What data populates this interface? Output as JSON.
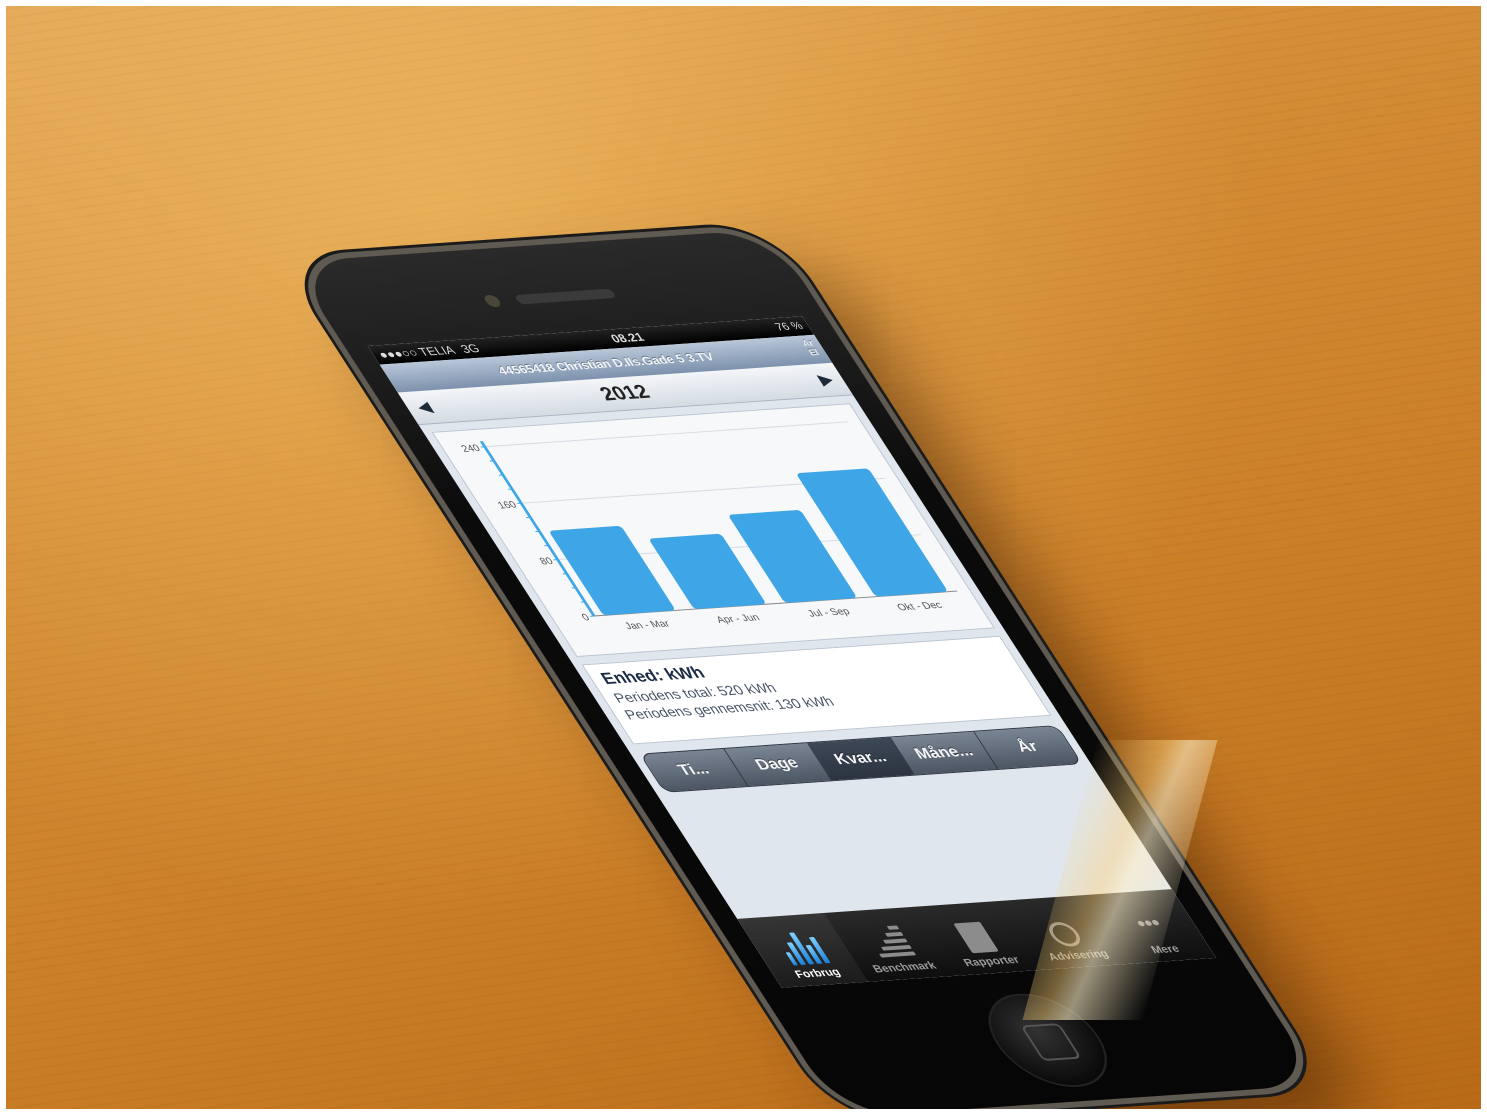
{
  "status": {
    "carrier": "●●●○○ TELIA",
    "network": "3G",
    "time": "08.21",
    "battery": "76 %"
  },
  "header": {
    "title": "44565418 Christian D.Ils.Gade 5 3.TV",
    "corner_top": "Ar",
    "corner_bottom": "El"
  },
  "period": {
    "year": "2012",
    "prev_arrow": "◀",
    "next_arrow": "▶"
  },
  "chart_data": {
    "type": "bar",
    "categories": [
      "Jan - Mar",
      "Apr - Jun",
      "Jul - Sep",
      "Okt - Dec"
    ],
    "values": [
      120,
      100,
      125,
      175
    ],
    "ylim": [
      0,
      240
    ],
    "yticks": [
      "0",
      "80",
      "160",
      "240"
    ],
    "bar_color": "#3ea6e6",
    "grid": true
  },
  "summary": {
    "unit": "Enhed: kWh",
    "total": "Periodens total: 520 kWh",
    "average": "Periodens gennemsnit: 130 kWh"
  },
  "segments": [
    "Ti...",
    "Dage",
    "Kvar...",
    "Måne...",
    "År"
  ],
  "segment_active": 2,
  "tabs": [
    {
      "label": "Forbrug",
      "icon": "bar-chart-icon"
    },
    {
      "label": "Benchmark",
      "icon": "list-icon"
    },
    {
      "label": "Rapporter",
      "icon": "report-icon"
    },
    {
      "label": "Advisering",
      "icon": "alarm-clock-icon"
    },
    {
      "label": "Mere",
      "icon": "more-icon"
    }
  ],
  "tab_active": 0
}
